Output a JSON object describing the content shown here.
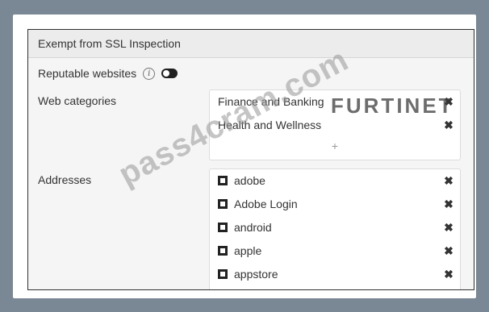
{
  "panel": {
    "title": "Exempt from SSL Inspection"
  },
  "reputable": {
    "label": "Reputable websites",
    "info_icon": "info-icon",
    "toggle_state": "off"
  },
  "web_categories": {
    "label": "Web categories",
    "items": [
      "Finance and Banking",
      "Health and Wellness"
    ],
    "add_symbol": "+"
  },
  "addresses": {
    "label": "Addresses",
    "items": [
      "adobe",
      "Adobe Login",
      "android",
      "apple",
      "appstore"
    ]
  },
  "remove_symbol": "✖",
  "watermark": "pass4cram.com",
  "logo": "FURTINET"
}
